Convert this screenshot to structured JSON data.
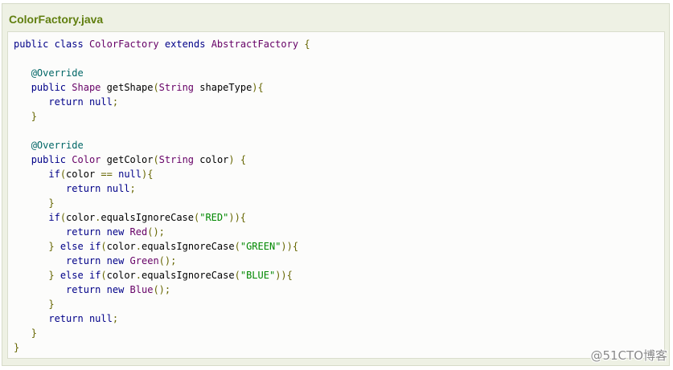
{
  "example": {
    "title": "ColorFactory.java",
    "code": {
      "lines": [
        "public class ColorFactory extends AbstractFactory {",
        "",
        "   @Override",
        "   public Shape getShape(String shapeType){",
        "      return null;",
        "   }",
        "",
        "   @Override",
        "   public Color getColor(String color) {",
        "      if(color == null){",
        "         return null;",
        "      }",
        "      if(color.equalsIgnoreCase(\"RED\")){",
        "         return new Red();",
        "      } else if(color.equalsIgnoreCase(\"GREEN\")){",
        "         return new Green();",
        "      } else if(color.equalsIgnoreCase(\"BLUE\")){",
        "         return new Blue();",
        "      }",
        "      return null;",
        "   }",
        "}"
      ]
    }
  },
  "watermark": "@51CTO博客",
  "colors": {
    "title": "#617f10",
    "panel_background": "#eef1e4",
    "code_background": "#fcfcfb",
    "keyword": "#000088",
    "type": "#660066",
    "string": "#008800",
    "annotation": "#006666",
    "punctuation": "#666600"
  }
}
